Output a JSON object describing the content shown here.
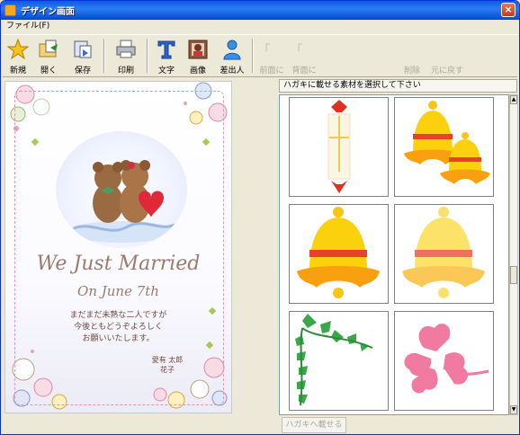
{
  "window": {
    "title": "デザイン画面",
    "close_label": "×"
  },
  "menu": {
    "file": "ファイル(F)"
  },
  "toolbar": {
    "new": "新規",
    "open": "開く",
    "save": "保存",
    "print": "印刷",
    "text": "文字",
    "image": "画像",
    "sender": "差出人",
    "front": "前面に",
    "back": "背面に",
    "delete": "削除",
    "undo": "元に戻す"
  },
  "card": {
    "title": "We Just Married",
    "date": "On June 7th",
    "message": [
      "まだまだ未熟な二人ですが",
      "今後ともどうぞよろしく",
      "お願いいたします。"
    ],
    "names": [
      "愛有 太郎",
      "花子"
    ]
  },
  "panel": {
    "instruction": "ハガキに載せる素材を選択して下さい"
  },
  "materials": [
    {
      "name": "ribbon-ornament"
    },
    {
      "name": "double-bell"
    },
    {
      "name": "yellow-bell"
    },
    {
      "name": "light-bell"
    },
    {
      "name": "ivy-corner"
    },
    {
      "name": "pink-clover"
    }
  ],
  "bottom": {
    "place_button": "ハガキへ載せる"
  }
}
